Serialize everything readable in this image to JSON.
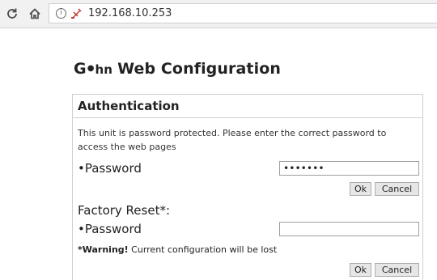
{
  "browser": {
    "address_bar": {
      "url": "192.168.10.253",
      "info_icon": "i"
    },
    "icons": {
      "reload": "reload-icon",
      "home": "home-icon",
      "info": "info-icon",
      "insecure": "not-secure-icon"
    }
  },
  "page": {
    "title_logo_g": "G",
    "title_logo_hn": "hn",
    "title_text": "Web Configuration"
  },
  "auth": {
    "heading": "Authentication",
    "description": "This unit is password protected. Please enter the correct password to access the web pages",
    "password_label": "•Password",
    "password_value": "•••••••",
    "ok_label": "Ok",
    "cancel_label": "Cancel"
  },
  "factory_reset": {
    "heading": "Factory Reset*:",
    "password_label": "•Password",
    "password_value": "",
    "warning_bold": "*Warning!",
    "warning_text": " Current configuration will be lost",
    "ok_label": "Ok",
    "cancel_label": "Cancel"
  },
  "colors": {
    "toolbar_bg": "#f1f1f1",
    "border": "#cfcfcf",
    "button_bg": "#e6e6e6",
    "insecure_icon": "#c0392b"
  }
}
